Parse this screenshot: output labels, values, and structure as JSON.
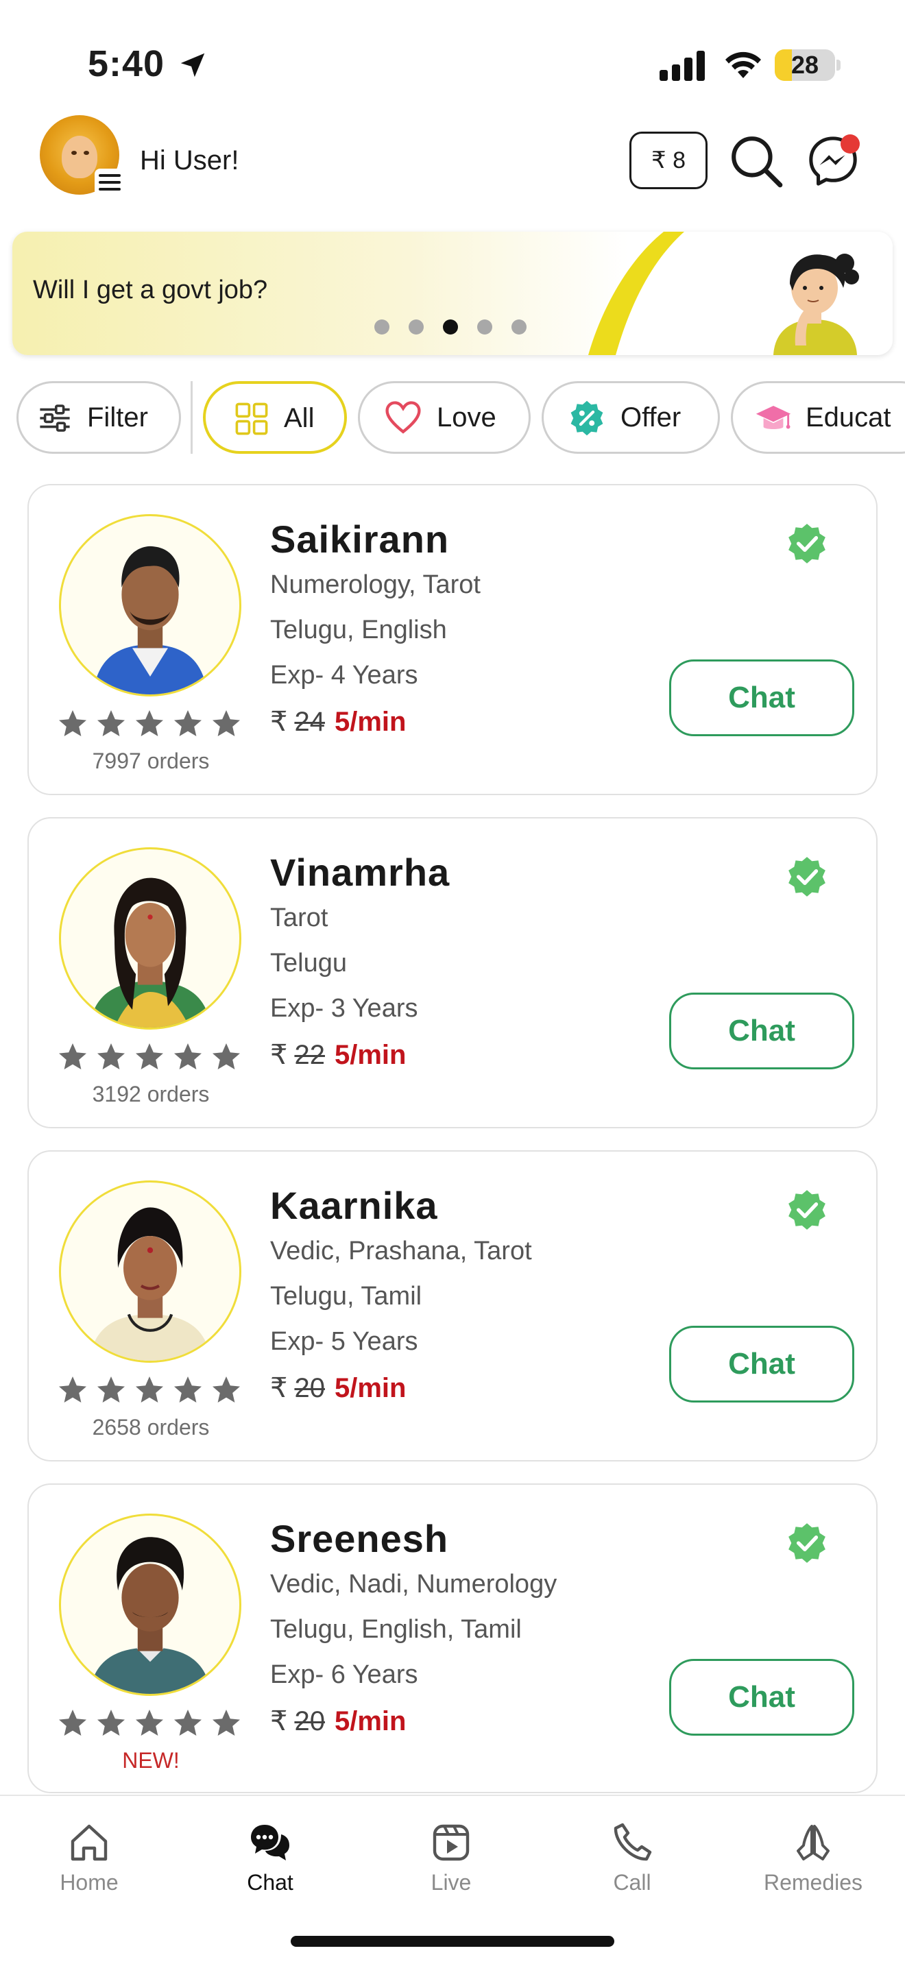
{
  "status_bar": {
    "time": "5:40",
    "battery": "28",
    "battery_level": 0.28
  },
  "header": {
    "greeting": "Hi User!",
    "wallet": "₹ 8",
    "notification_dot_color": "#e53935"
  },
  "banner": {
    "text": "Will I get a govt job?",
    "slides": 5,
    "active_slide": 3
  },
  "filters": [
    {
      "label": "Filter",
      "icon": "sliders-icon"
    },
    {
      "label": "All",
      "icon": "grid-icon",
      "active": true
    },
    {
      "label": "Love",
      "icon": "heart-icon"
    },
    {
      "label": "Offer",
      "icon": "discount-icon"
    },
    {
      "label": "Educat",
      "icon": "graduation-cap-icon"
    }
  ],
  "astrologers": [
    {
      "name": "Saikirann",
      "skills": "Numerology,  Tarot",
      "languages": "Telugu, English",
      "experience": "Exp- 4 Years",
      "currency": "₹",
      "old_price": "24",
      "price": "5/min",
      "orders": "7997 orders",
      "rating": 5,
      "chat_label": "Chat"
    },
    {
      "name": "Vinamrha",
      "skills": "Tarot",
      "languages": "Telugu",
      "experience": "Exp- 3 Years",
      "currency": "₹",
      "old_price": "22",
      "price": "5/min",
      "orders": "3192 orders",
      "rating": 5,
      "chat_label": "Chat"
    },
    {
      "name": "Kaarnika",
      "skills": "Vedic,  Prashana,  Tarot",
      "languages": "Telugu, Tamil",
      "experience": "Exp- 5 Years",
      "currency": "₹",
      "old_price": "20",
      "price": "5/min",
      "orders": "2658 orders",
      "rating": 5,
      "chat_label": "Chat"
    },
    {
      "name": "Sreenesh",
      "skills": "Vedic,  Nadi,  Numerology",
      "languages": "Telugu, English, Tamil",
      "experience": "Exp- 6 Years",
      "currency": "₹",
      "old_price": "20",
      "price": "5/min",
      "orders": "NEW!",
      "rating": 5,
      "chat_label": "Chat"
    }
  ],
  "bottom_nav": [
    {
      "label": "Home",
      "icon": "home-icon"
    },
    {
      "label": "Chat",
      "icon": "chat-bubbles-icon",
      "active": true
    },
    {
      "label": "Live",
      "icon": "live-play-icon"
    },
    {
      "label": "Call",
      "icon": "phone-icon"
    },
    {
      "label": "Remedies",
      "icon": "praying-hands-icon"
    }
  ],
  "colors": {
    "accent_yellow": "#e6d21e",
    "chat_green": "#2e9b5c",
    "price_red": "#c1141c",
    "verified_green": "#5cc26a"
  }
}
